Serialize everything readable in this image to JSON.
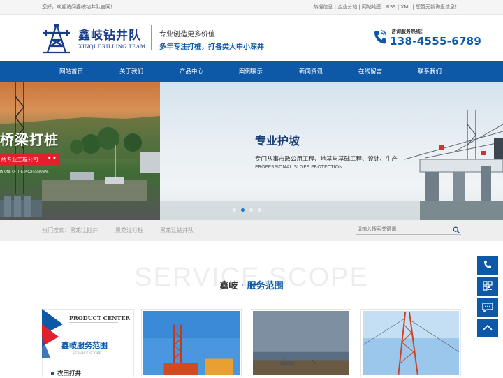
{
  "topbar": {
    "welcome": "您好，欢迎访问鑫岐钻井队官网！",
    "links": [
      "热搜信息",
      "企业分站",
      "网站地图",
      "RSS",
      "XML",
      "您暂无新询盘信息！"
    ]
  },
  "header": {
    "logo_name": "鑫岐钻井队",
    "logo_en": "XINQI DRILLING TEAM",
    "slogan1": "专业创造更多价值",
    "slogan2": "多年专注打桩，打各类大中小深井",
    "hotline_label": "咨询服务热线：",
    "hotline_number": "138-4555-6789"
  },
  "nav": {
    "items": [
      "网站首页",
      "关于我们",
      "产品中心",
      "案例展示",
      "新闻资讯",
      "在线留言",
      "联系我们"
    ]
  },
  "banner": {
    "left_title": "桥梁打桩",
    "left_tag": "的专业工程公司",
    "left_small": "IN ONE OF THE PROFESSIONAL",
    "right_title": "专业护坡",
    "right_desc": "专门从事市政公用工程、地基与基础工程、设计、生产",
    "right_en": "PROFESSIONAL SLOPE PROTECTION",
    "active_slide": 1
  },
  "search": {
    "hot_label": "热门搜索：",
    "keywords": [
      "黑龙江打井",
      "黑龙江打桩",
      "黑龙江钻井队"
    ],
    "placeholder": "请输入搜索关键词"
  },
  "scope": {
    "bg_text": "SERVICE SCOPE",
    "title_a": "鑫岐",
    "title_sep": "·",
    "title_b": "服务范围"
  },
  "sidebar": {
    "product_center_en": "PRODUCT CENTER",
    "title": "鑫岐服务范围",
    "subtitle": "SERVICE SCOPE",
    "items": [
      "农田打井"
    ]
  },
  "colors": {
    "brand": "#0e58a8",
    "accent_red": "#e0202a",
    "nav_bg": "#0e58a8"
  },
  "floatbar": {
    "icons": [
      "phone-icon",
      "qrcode-icon",
      "chat-icon",
      "back-to-top-icon"
    ]
  }
}
